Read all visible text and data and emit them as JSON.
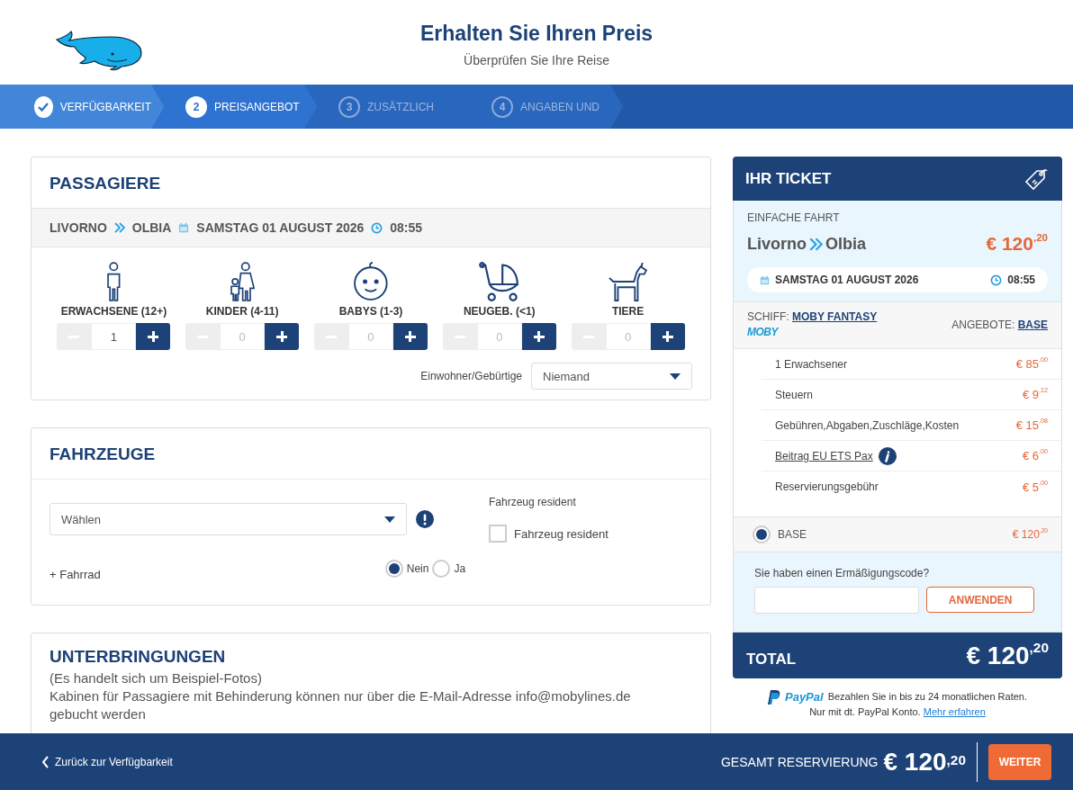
{
  "header": {
    "title": "Erhalten Sie Ihren Preis",
    "subtitle": "Überprüfen Sie Ihre Reise"
  },
  "steps": [
    {
      "label": "VERFÜGBARKEIT",
      "done": true,
      "selected": false
    },
    {
      "number": "2",
      "label": "PREISANGEBOT",
      "done": false,
      "selected": true
    },
    {
      "number": "3",
      "label": "ZUSÄTZLICH",
      "done": false,
      "selected": false
    },
    {
      "number": "4",
      "label": "ANGABEN UND",
      "done": false,
      "selected": false
    }
  ],
  "passengers": {
    "title": "PASSAGIERE",
    "trip": {
      "from": "LIVORNO",
      "to": "OLBIA",
      "date": "SAMSTAG 01 AUGUST 2026",
      "time": "08:55"
    },
    "counters": [
      {
        "kind": "adult",
        "label": "ERWACHSENE (12+)",
        "value": "1"
      },
      {
        "kind": "child",
        "label": "KINDER (4-11)",
        "placeholder": "0"
      },
      {
        "kind": "baby",
        "label": "BABYS (1-3)",
        "placeholder": "0"
      },
      {
        "kind": "newborn",
        "label": "NEUGEB. (<1)",
        "placeholder": "0"
      },
      {
        "kind": "pet",
        "label": "TIERE",
        "placeholder": "0"
      }
    ],
    "resident": {
      "label": "Einwohner/Gebürtige",
      "value": "Niemand"
    }
  },
  "vehicles": {
    "title": "FAHRZEUGE",
    "select": "Wählen",
    "resident_label": "Fahrzeug resident",
    "resident_checkbox": {
      "label": "Fahrzeug resident",
      "checked": false
    },
    "bicycle": {
      "label": "+ Fahrrad",
      "options": [
        {
          "label": "Nein",
          "selected": true
        },
        {
          "label": "Ja",
          "selected": false
        }
      ]
    }
  },
  "accommodations": {
    "title": "UNTERBRINGUNGEN",
    "note": "(Es handelt sich um Beispiel-Fotos)",
    "text": "Kabinen für Passagiere mit Behinderung können nur über die E-Mail-Adresse info@mobylines.de gebucht werden"
  },
  "ticket": {
    "title": "IHR TICKET",
    "trip_type": "EINFACHE FAHRT",
    "from": "Livorno",
    "to": "Olbia",
    "price": "€ 120$^{,20}$",
    "date": "SAMSTAG 01 AUGUST 2026",
    "time": "08:55",
    "ship_label": "SCHIFF:",
    "ship": "MOBY FANTASY",
    "logo": "MOBY",
    "offers_label": "ANGEBOTE:",
    "offer": "BASE",
    "items": [
      {
        "label": "1 Erwachsener",
        "price": "€ 85$^{,00}$",
        "kind": "plain"
      },
      {
        "label": "Steuern",
        "price": "€ 9$^{,12}$",
        "kind": "plain"
      },
      {
        "label": "Gebühren,Abgaben,Zuschläge,Kosten",
        "price": "€ 15$^{,08}$",
        "kind": "plain"
      },
      {
        "label": "Beitrag EU ETS Pax",
        "price": "€ 6$^{,00}$",
        "kind": "link"
      },
      {
        "label": "Reservierungsgebühr",
        "price": "€ 5$^{,00}$",
        "kind": "plain"
      }
    ],
    "fare": {
      "label": "BASE",
      "price": "€ 120$^{,20}$",
      "selected": true
    },
    "discount": {
      "label": "Sie haben einen Ermäßigungscode?",
      "button": "ANWENDEN"
    },
    "total": {
      "label": "TOTAL",
      "price": "€ 120$^{,20}$"
    }
  },
  "paypal": {
    "brand": "PayPal",
    "text": "Bezahlen Sie in bis zu 24 monatlichen Raten.",
    "note": "Nur mit dt. PayPal Konto.",
    "link": "Mehr erfahren"
  },
  "footer": {
    "back": "Zurück zur Verfügbarkeit",
    "total_label": "GESAMT RESERVIERUNG",
    "total": "€ 120$^{,20}$",
    "next": "WEITER"
  }
}
